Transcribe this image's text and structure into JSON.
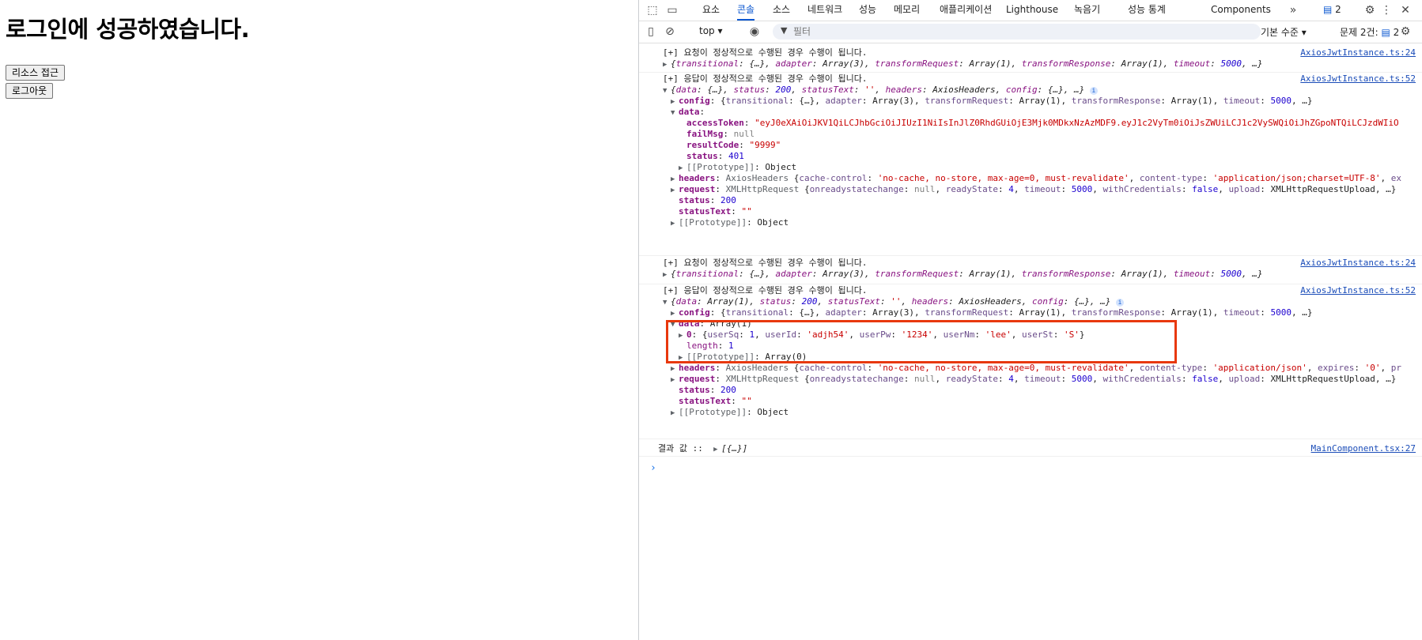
{
  "page": {
    "title": "로그인에 성공하였습니다.",
    "btn_resource": "리소스 접근",
    "btn_logout": "로그아웃"
  },
  "devtools": {
    "tabs": [
      "요소",
      "콘솔",
      "소스",
      "네트워크",
      "성능",
      "메모리",
      "애플리케이션",
      "Lighthouse",
      "녹음기",
      "성능 통계",
      "Components"
    ],
    "active_tab": "콘솔",
    "issue_count": "2",
    "context": "top",
    "filter_placeholder": "필터",
    "level": "기본 수준",
    "issues_label": "문제 2건:",
    "issues_count": "2"
  },
  "console": {
    "m1": {
      "text": "[+] 요청이 정상적으로 수행된 경우 수행이 됩니다.",
      "link": "AxiosJwtInstance.ts:24"
    },
    "m2": {
      "text": "[+] 응답이 정상적으로 수행된 경우 수행이 됩니다.",
      "link": "AxiosJwtInstance.ts:52",
      "access_token": "\"eyJ0eXAiOiJKV1QiLCJhbGciOiJIUzI1NiIsInJlZ0RhdGUiOjE3Mjk0MDkxNzAzMDF9.eyJ1c2VyTm0iOiJsZWUiLCJ1c2VySWQiOiJhZGpoNTQiLCJzdWIiO",
      "fail_msg": "null",
      "result_code": "\"9999\"",
      "status": "401",
      "status200": "200",
      "status_text": "\"\""
    },
    "m3": {
      "text": "[+] 요청이 정상적으로 수행된 경우 수행이 됩니다.",
      "link": "AxiosJwtInstance.ts:24"
    },
    "m4": {
      "text": "[+] 응답이 정상적으로 수행된 경우 수행이 됩니다.",
      "link": "AxiosJwtInstance.ts:52",
      "user_sq": "1",
      "user_id": "'adjh54'",
      "user_pw": "'1234'",
      "user_nm": "'lee'",
      "user_st": "'S'",
      "length": "1",
      "status": "200",
      "status_text": "\"\""
    },
    "m5": {
      "label": "결과 값 ::",
      "value": "[{…}]",
      "link": "MainComponent.tsx:27"
    }
  },
  "colors": {
    "accent": "#0b57d0",
    "highlight_box": "#e8380d",
    "string": "#c80000",
    "number": "#1c00cf",
    "key": "#881280"
  }
}
